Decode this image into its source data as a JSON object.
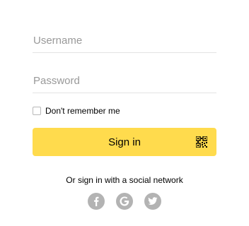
{
  "username": {
    "placeholder": "Username",
    "value": ""
  },
  "password": {
    "placeholder": "Password",
    "value": ""
  },
  "remember": {
    "label": "Don't remember me",
    "checked": false
  },
  "signin": {
    "label": "Sign in",
    "accent": "#ffdb4d"
  },
  "social": {
    "title": "Or sign in with a social network",
    "providers": [
      {
        "name": "facebook-icon"
      },
      {
        "name": "google-icon"
      },
      {
        "name": "twitter-icon"
      }
    ],
    "icon_color": "#b3b3b3"
  }
}
